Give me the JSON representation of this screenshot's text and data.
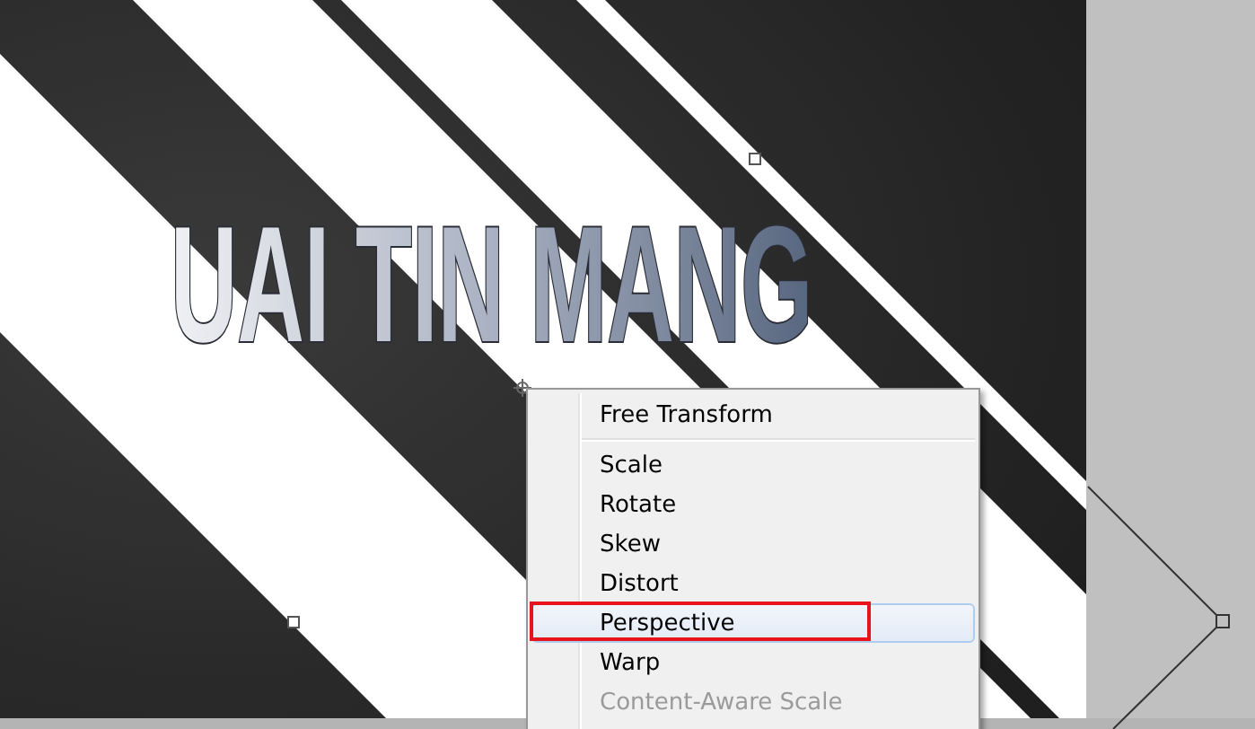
{
  "canvas": {
    "title": "UAI TIN MANG"
  },
  "context_menu": {
    "items": [
      {
        "kind": "item",
        "label": "Free Transform",
        "selected": false,
        "disabled": false,
        "annotated": false
      },
      {
        "kind": "separator"
      },
      {
        "kind": "item",
        "label": "Scale",
        "selected": false,
        "disabled": false,
        "annotated": false
      },
      {
        "kind": "item",
        "label": "Rotate",
        "selected": false,
        "disabled": false,
        "annotated": false
      },
      {
        "kind": "item",
        "label": "Skew",
        "selected": false,
        "disabled": false,
        "annotated": false
      },
      {
        "kind": "item",
        "label": "Distort",
        "selected": false,
        "disabled": false,
        "annotated": false
      },
      {
        "kind": "item",
        "label": "Perspective",
        "selected": true,
        "disabled": false,
        "annotated": true
      },
      {
        "kind": "item",
        "label": "Warp",
        "selected": false,
        "disabled": false,
        "annotated": false
      },
      {
        "kind": "item",
        "label": "Content-Aware Scale",
        "selected": false,
        "disabled": true,
        "annotated": false
      }
    ]
  }
}
